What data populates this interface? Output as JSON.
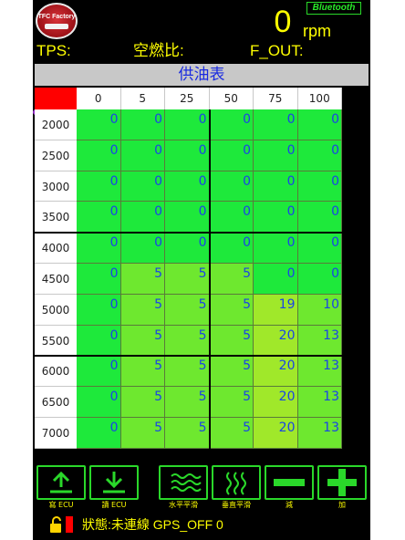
{
  "header": {
    "logo_text": "TFC Factory",
    "bluetooth": "Bluetooth",
    "rpm_value": "0",
    "rpm_unit": "rpm",
    "tps_label": "TPS:",
    "afr_label": "空燃比:",
    "fout_label": "F_OUT:"
  },
  "table": {
    "title": "供油表",
    "columns": [
      "0",
      "5",
      "25",
      "50",
      "75",
      "100"
    ],
    "rows": [
      {
        "rpm": "2000",
        "values": [
          "0",
          "0",
          "0",
          "0",
          "0",
          "0"
        ]
      },
      {
        "rpm": "2500",
        "values": [
          "0",
          "0",
          "0",
          "0",
          "0",
          "0"
        ]
      },
      {
        "rpm": "3000",
        "values": [
          "0",
          "0",
          "0",
          "0",
          "0",
          "0"
        ]
      },
      {
        "rpm": "3500",
        "values": [
          "0",
          "0",
          "0",
          "0",
          "0",
          "0"
        ]
      },
      {
        "rpm": "4000",
        "values": [
          "0",
          "0",
          "0",
          "0",
          "0",
          "0"
        ]
      },
      {
        "rpm": "4500",
        "values": [
          "0",
          "5",
          "5",
          "5",
          "0",
          "0"
        ]
      },
      {
        "rpm": "5000",
        "values": [
          "0",
          "5",
          "5",
          "5",
          "19",
          "10"
        ]
      },
      {
        "rpm": "5500",
        "values": [
          "0",
          "5",
          "5",
          "5",
          "20",
          "13"
        ]
      },
      {
        "rpm": "6000",
        "values": [
          "0",
          "5",
          "5",
          "5",
          "20",
          "13"
        ]
      },
      {
        "rpm": "6500",
        "values": [
          "0",
          "5",
          "5",
          "5",
          "20",
          "13"
        ]
      },
      {
        "rpm": "7000",
        "values": [
          "0",
          "5",
          "5",
          "5",
          "20",
          "13"
        ]
      }
    ]
  },
  "toolbar": {
    "write_ecu": "寫 ECU",
    "read_ecu": "讀 ECU",
    "h_smooth": "水平平滑",
    "v_smooth": "垂直平滑",
    "minus": "減",
    "plus": "加"
  },
  "status": {
    "text": "狀態:未連線 GPS_OFF 0"
  },
  "colors": {
    "accent": "#ffff00",
    "button_border": "#2ad82a",
    "cell_green": "#1ee93b",
    "cell_lime": "#a0e82a",
    "value_text": "#1a44e6"
  }
}
